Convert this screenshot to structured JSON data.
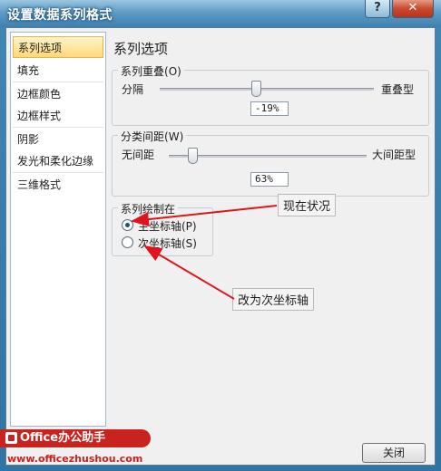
{
  "window": {
    "title": "设置数据系列格式",
    "help_glyph": "?",
    "close_glyph": "✕"
  },
  "nav": {
    "items": [
      "系列选项",
      "填充",
      "边框颜色",
      "边框样式",
      "阴影",
      "发光和柔化边缘",
      "三维格式"
    ],
    "selected": 0
  },
  "content": {
    "section_title": "系列选项",
    "overlap": {
      "label": "系列重叠",
      "hotkey": "(O)",
      "min_label": "分隔",
      "max_label": "重叠型",
      "value": "-19%",
      "fraction": 0.45
    },
    "gap": {
      "label": "分类间距",
      "hotkey": "(W)",
      "min_label": "无间距",
      "max_label": "大间距型",
      "value": "63%",
      "fraction": 0.12
    },
    "plot_on": {
      "label": "系列绘制在",
      "options": [
        "主坐标轴(P)",
        "次坐标轴(S)"
      ],
      "selected": 0
    }
  },
  "annotations": {
    "current": "现在状况",
    "change_to": "改为次坐标轴"
  },
  "footer": {
    "close_label": "关闭"
  },
  "watermark": {
    "brand": "Office办公助手",
    "site": "www.officezhushou.com"
  },
  "colors": {
    "arrow": "#e0141c",
    "title_bar": "#5f9cc6"
  }
}
